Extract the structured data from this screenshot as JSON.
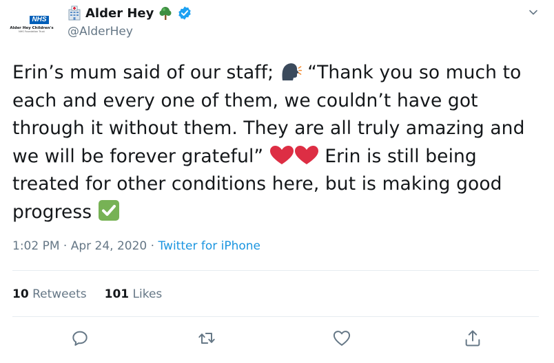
{
  "author": {
    "avatar": {
      "badge": "NHS",
      "org_name": "Alder Hey Children's",
      "org_sub": "NHS Foundation Trust"
    },
    "display_name": "Alder Hey",
    "handle": "@AlderHey",
    "emoji_icons": [
      "hospital-icon",
      "tree-icon",
      "verified-icon"
    ]
  },
  "tweet": {
    "lines": [
      [
        "Erin’s mum said of our staff; ",
        "“Thank you so much to"
      ],
      "each and every one of them, we couldn’t have got",
      "through it without them. They are all truly amazing and",
      [
        "we will be forever grateful” ",
        " Erin is still being"
      ],
      "treated for other conditions here, but is making good",
      "progress"
    ]
  },
  "meta": {
    "time": "1:02 PM",
    "separator": " · ",
    "date": "Apr 24, 2020",
    "source": "Twitter for iPhone"
  },
  "stats": {
    "retweets_count": "10",
    "retweets_label": "Retweets",
    "likes_count": "101",
    "likes_label": "Likes"
  },
  "colors": {
    "text": "#14171a",
    "secondary": "#657786",
    "link": "#1b95e0",
    "divider": "#e6ecf0",
    "nhs_blue": "#005eb8",
    "heart_red": "#dd2e44",
    "check_green": "#77b255",
    "verified_blue": "#1da1f2"
  },
  "actions": [
    "reply-icon",
    "retweet-icon",
    "like-icon",
    "share-icon"
  ]
}
